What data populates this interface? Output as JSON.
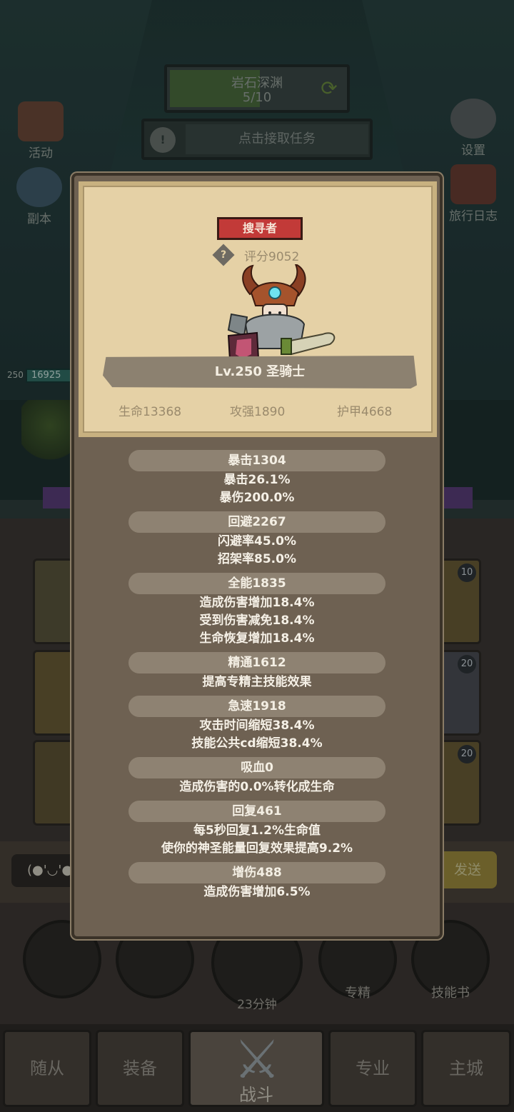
{
  "background": {
    "quest": {
      "title": "岩石深渊",
      "progress_text": "5/10",
      "progress_fraction": 0.5
    },
    "task_bar": {
      "alert_icon": "exclamation-icon",
      "label": "点击接取任务"
    },
    "side_left": [
      {
        "label": "活动",
        "icon": "calendar-icon"
      },
      {
        "label": "副本",
        "icon": "portal-icon"
      }
    ],
    "side_right": [
      {
        "label": "设置",
        "icon": "gear-icon"
      },
      {
        "label": "旅行日志",
        "icon": "journal-icon"
      }
    ],
    "hero_bar": {
      "level": "250",
      "hp": "16925"
    },
    "equipment_levels": [
      "10",
      "20",
      "20"
    ],
    "chat": {
      "emote": "(●'◡'●",
      "send_label": "发送"
    },
    "actions": [
      {
        "label": "",
        "icon": "potion-icon"
      },
      {
        "label": "",
        "icon": "bread-icon"
      },
      {
        "label": "23分钟",
        "icon": "chest-icon"
      },
      {
        "label": "专精",
        "icon": "specialization-icon"
      },
      {
        "label": "技能书",
        "icon": "skillbook-icon"
      }
    ],
    "nav": [
      {
        "label": "随从"
      },
      {
        "label": "装备"
      },
      {
        "label": "战斗"
      },
      {
        "label": "专业"
      },
      {
        "label": "主城"
      }
    ]
  },
  "modal": {
    "class_badge": "搜寻者",
    "score_icon": "question-icon",
    "score": "评分9052",
    "level_title": "Lv.250 圣骑士",
    "basic_stats": [
      "生命13368",
      "攻强1890",
      "护甲4668"
    ],
    "stat_groups": [
      {
        "header": "暴击1304",
        "lines": [
          "暴击26.1%",
          "暴伤200.0%"
        ]
      },
      {
        "header": "回避2267",
        "lines": [
          "闪避率45.0%",
          "招架率85.0%"
        ]
      },
      {
        "header": "全能1835",
        "lines": [
          "造成伤害增加18.4%",
          "受到伤害减免18.4%",
          "生命恢复增加18.4%"
        ]
      },
      {
        "header": "精通1612",
        "lines": [
          "提高专精主技能效果"
        ]
      },
      {
        "header": "急速1918",
        "lines": [
          "攻击时间缩短38.4%",
          "技能公共cd缩短38.4%"
        ]
      },
      {
        "header": "吸血0",
        "lines": [
          "造成伤害的0.0%转化成生命"
        ]
      },
      {
        "header": "回复461",
        "lines": [
          "每5秒回复1.2%生命值",
          "使你的神圣能量回复效果提高9.2%"
        ]
      },
      {
        "header": "增伤488",
        "lines": [
          "造成伤害增加6.5%"
        ]
      }
    ]
  }
}
